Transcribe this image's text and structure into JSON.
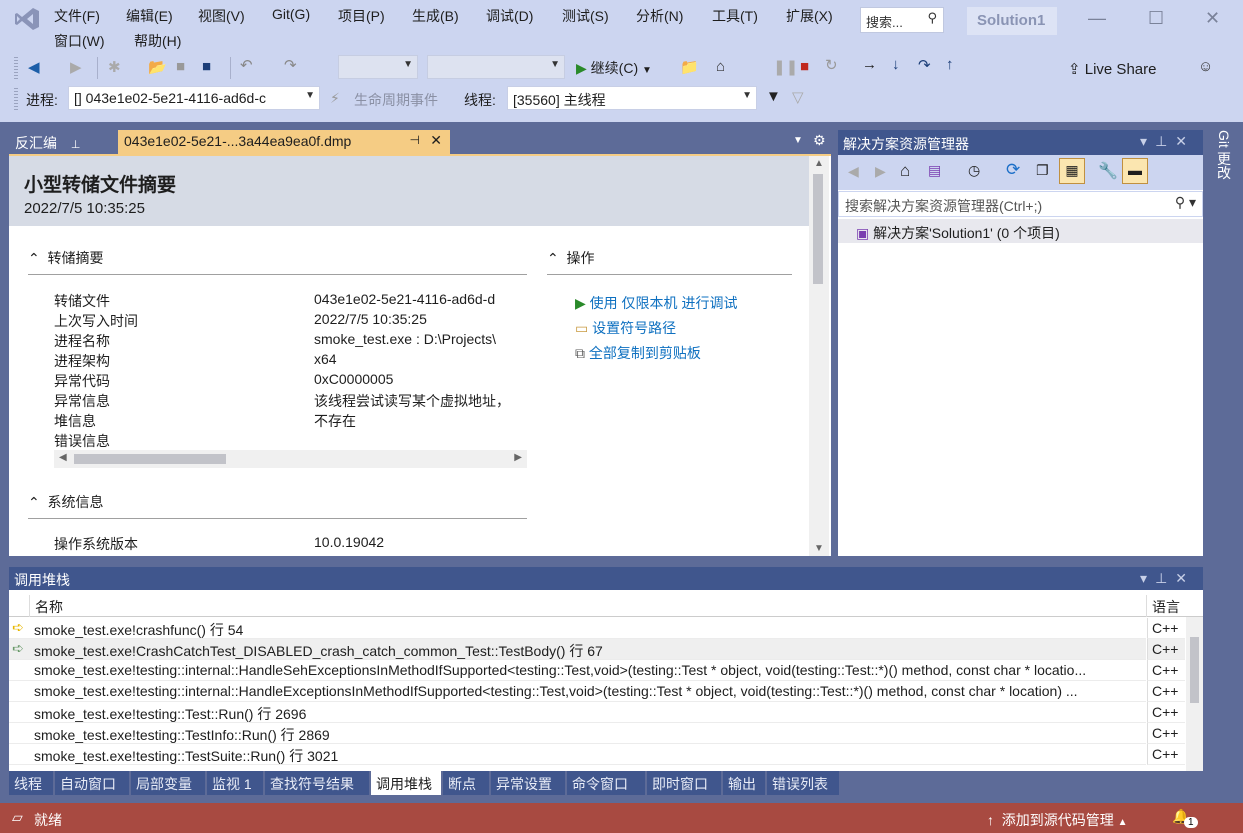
{
  "menu": {
    "items": [
      "文件(F)",
      "编辑(E)",
      "视图(V)",
      "Git(G)",
      "项目(P)",
      "生成(B)",
      "调试(D)",
      "测试(S)",
      "分析(N)",
      "工具(T)",
      "扩展(X)",
      "窗口(W)",
      "帮助(H)"
    ],
    "search_placeholder": "搜索...",
    "solution_name": "Solution1"
  },
  "toolbar": {
    "continue_label": "继续(C)",
    "live_share": "Live Share"
  },
  "debug_location": {
    "process_label": "进程:",
    "process_value": "[] 043e1e02-5e21-4116-ad6d-c",
    "lifecycle_label": "生命周期事件",
    "thread_label": "线程:",
    "thread_value": "[35560] 主线程"
  },
  "doc_tabs": {
    "disasm": "反汇编",
    "dump": "043e1e02-5e21-...3a44ea9ea0f.dmp"
  },
  "dump": {
    "title": "小型转储文件摘要",
    "timestamp": "2022/7/5 10:35:25",
    "summary_header": "转储摘要",
    "summary": [
      {
        "k": "转储文件",
        "v": "043e1e02-5e21-4116-ad6d-d"
      },
      {
        "k": "上次写入时间",
        "v": "2022/7/5 10:35:25"
      },
      {
        "k": "进程名称",
        "v": "smoke_test.exe : D:\\Projects\\"
      },
      {
        "k": "进程架构",
        "v": "x64"
      },
      {
        "k": "异常代码",
        "v": "0xC0000005"
      },
      {
        "k": "异常信息",
        "v": "该线程尝试读写某个虚拟地址，"
      },
      {
        "k": "堆信息",
        "v": "不存在"
      },
      {
        "k": "错误信息",
        "v": ""
      }
    ],
    "actions_header": "操作",
    "actions": [
      "使用 仅限本机 进行调试",
      "设置符号路径",
      "全部复制到剪贴板"
    ],
    "system_header": "系统信息",
    "system": [
      {
        "k": "操作系统版本",
        "v": "10.0.19042"
      }
    ]
  },
  "solution_explorer": {
    "title": "解决方案资源管理器",
    "search_placeholder": "搜索解决方案资源管理器(Ctrl+;)",
    "root": "解决方案'Solution1' (0 个项目)"
  },
  "git_tab": "Git 更改",
  "call_stack": {
    "title": "调用堆栈",
    "col_name": "名称",
    "col_lang": "语言",
    "rows": [
      {
        "name": "smoke_test.exe!crashfunc() 行 54",
        "lang": "C++",
        "marker": "current"
      },
      {
        "name": "smoke_test.exe!CrashCatchTest_DISABLED_crash_catch_common_Test::TestBody() 行 67",
        "lang": "C++",
        "marker": "caller"
      },
      {
        "name": "smoke_test.exe!testing::internal::HandleSehExceptionsInMethodIfSupported<testing::Test,void>(testing::Test * object, void(testing::Test::*)() method, const char * locatio...",
        "lang": "C++"
      },
      {
        "name": "smoke_test.exe!testing::internal::HandleExceptionsInMethodIfSupported<testing::Test,void>(testing::Test * object, void(testing::Test::*)() method, const char * location) ...",
        "lang": "C++"
      },
      {
        "name": "smoke_test.exe!testing::Test::Run() 行 2696",
        "lang": "C++"
      },
      {
        "name": "smoke_test.exe!testing::TestInfo::Run() 行 2869",
        "lang": "C++"
      },
      {
        "name": "smoke_test.exe!testing::TestSuite::Run() 行 3021",
        "lang": "C++"
      }
    ]
  },
  "bottom_tabs": [
    "线程",
    "自动窗口",
    "局部变量",
    "监视 1",
    "查找符号结果",
    "调用堆栈",
    "断点",
    "异常设置",
    "命令窗口",
    "即时窗口",
    "输出",
    "错误列表"
  ],
  "status": {
    "text": "就绪",
    "source_control": "添加到源代码管理",
    "notifications": "1"
  },
  "colors": {
    "frame": "#5d6b98",
    "title_bar": "#40568d",
    "active_doc_tab": "#f5cc84",
    "status_bar": "#a84a41"
  }
}
